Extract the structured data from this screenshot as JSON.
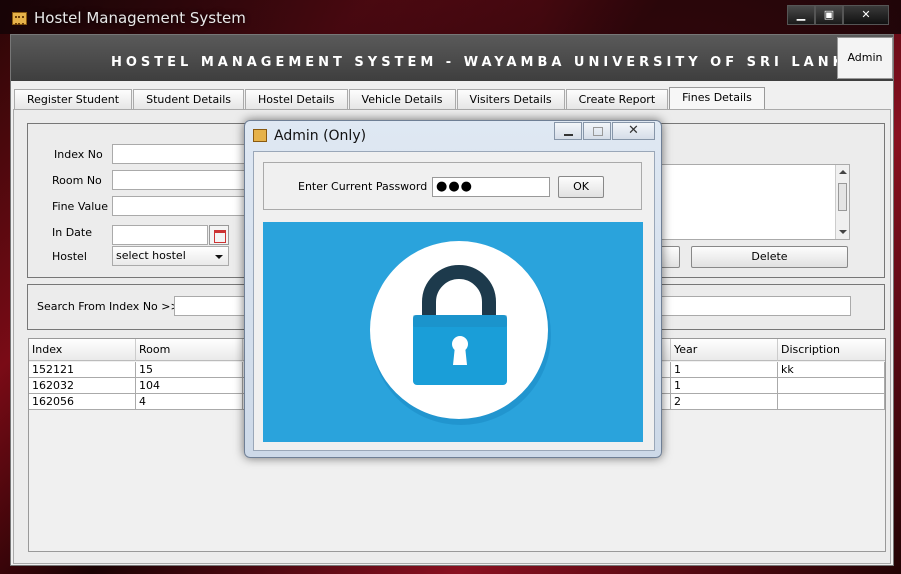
{
  "window": {
    "title": "Hostel Management System",
    "min_symbol": "▁",
    "max_symbol": "▣",
    "close_symbol": "✕"
  },
  "banner": {
    "title": "HOSTEL MANAGEMENT SYSTEM - WAYAMBA UNIVERSITY OF SRI LANKA",
    "admin_label": "Admin"
  },
  "tabs": [
    {
      "label": "Register Student"
    },
    {
      "label": "Student Details"
    },
    {
      "label": "Hostel Details"
    },
    {
      "label": "Vehicle Details"
    },
    {
      "label": "Visiters Details"
    },
    {
      "label": "Create Report"
    },
    {
      "label": "Fines Details",
      "active": true
    }
  ],
  "form": {
    "index_label": "Index No",
    "room_label": "Room No",
    "fine_label": "Fine Value",
    "date_label": "In Date",
    "hostel_label": "Hostel",
    "hostel_value": "select hostel",
    "delete_label": "Delete"
  },
  "search": {
    "label": "Search From Index No >>"
  },
  "table": {
    "columns": [
      "Index",
      "Room",
      "Year",
      "Discription"
    ],
    "rows": [
      {
        "index": "152121",
        "room": "15",
        "year": "1",
        "description": "kk"
      },
      {
        "index": "162032",
        "room": "104",
        "year": "1",
        "description": ""
      },
      {
        "index": "162056",
        "room": "4",
        "year": "2",
        "description": ""
      }
    ]
  },
  "dialog": {
    "title": "Admin (Only)",
    "close_symbol": "✕",
    "password_label": "Enter Current Password",
    "password_value": "●●●",
    "ok_label": "OK"
  },
  "colors": {
    "lock_background": "#2aa3dc",
    "lock_body": "#1a9ed8",
    "lock_shackle": "#1d3a4c"
  }
}
